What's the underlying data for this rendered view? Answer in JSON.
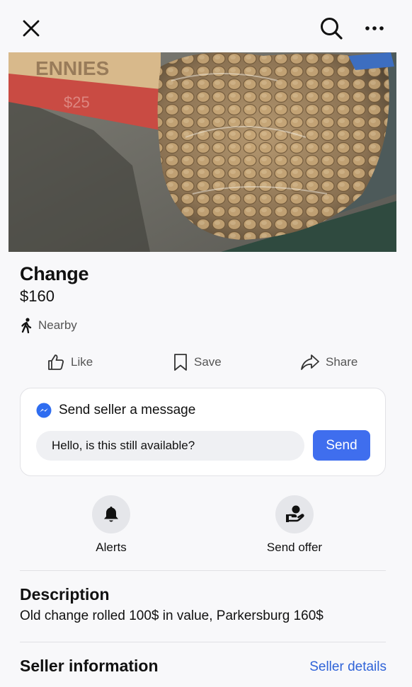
{
  "topbar": {
    "close_icon": "close-icon",
    "search_icon": "search-icon",
    "more_icon": "more-options-icon"
  },
  "listing": {
    "photo_icon": "listing-photo",
    "photo_box_text": [
      "ENNIES",
      "$25"
    ],
    "title": "Change",
    "price": "$160",
    "location": "Nearby"
  },
  "actions": {
    "like": "Like",
    "save": "Save",
    "share": "Share"
  },
  "message": {
    "heading": "Send seller a message",
    "input_value": "Hello, is this still available?",
    "send_label": "Send"
  },
  "quick_actions": {
    "alerts": "Alerts",
    "send_offer": "Send offer"
  },
  "description": {
    "heading": "Description",
    "text": "Old change rolled 100$ in value, Parkersburg 160$"
  },
  "seller": {
    "heading": "Seller information",
    "details_link": "Seller details"
  },
  "colors": {
    "accent": "#3f6eee",
    "link": "#2f63d8",
    "background": "#f8f8fa"
  }
}
